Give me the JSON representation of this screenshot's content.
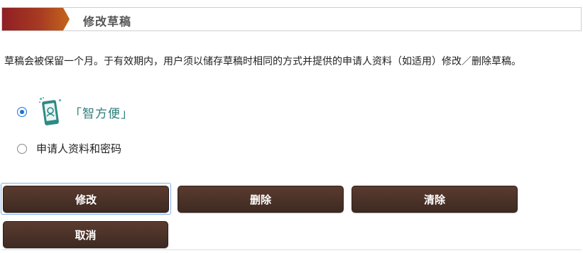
{
  "header": {
    "title": "修改草稿"
  },
  "description": "草稿会被保留一个月。于有效期内，用户须以储存草稿时相同的方式并提供的申请人资料（如适用）修改／删除草稿。",
  "options": {
    "smart": {
      "label": "「智方便」",
      "checked": true,
      "icon": "smartphone-app-icon"
    },
    "password": {
      "label": "申请人资料和密码",
      "checked": false
    }
  },
  "buttons": {
    "modify": "修改",
    "delete": "删除",
    "clear": "清除",
    "cancel": "取消"
  },
  "colors": {
    "accent_start": "#8f1f24",
    "accent_end": "#c4651c",
    "button_bg": "#4a3228",
    "smart_label": "#2d7e7a",
    "radio_selected": "#1a73d9"
  }
}
